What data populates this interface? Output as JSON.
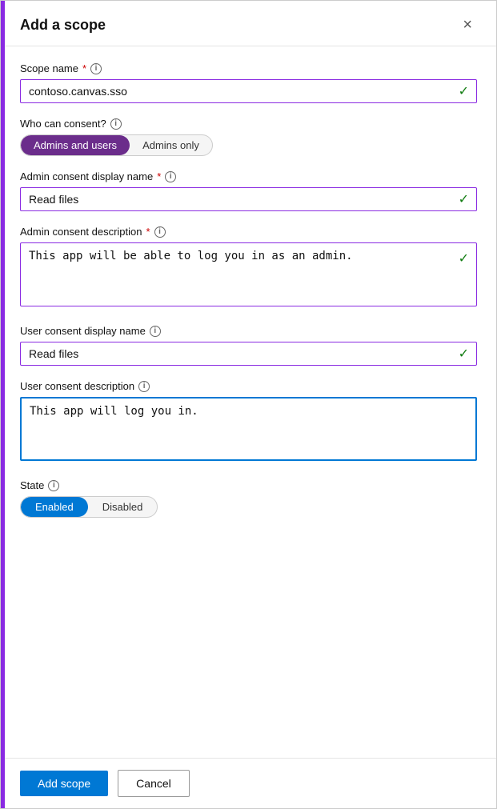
{
  "dialog": {
    "title": "Add a scope",
    "close_label": "×"
  },
  "scope_name": {
    "label": "Scope name",
    "required": true,
    "value": "contoso.canvas.sso",
    "placeholder": ""
  },
  "who_can_consent": {
    "label": "Who can consent?",
    "options": [
      {
        "id": "admins-users",
        "label": "Admins and users",
        "active": true
      },
      {
        "id": "admins-only",
        "label": "Admins only",
        "active": false
      }
    ]
  },
  "admin_consent_display_name": {
    "label": "Admin consent display name",
    "required": true,
    "value": "Read files",
    "placeholder": ""
  },
  "admin_consent_description": {
    "label": "Admin consent description",
    "required": true,
    "value": "This app will be able to log you in as an admin."
  },
  "user_consent_display_name": {
    "label": "User consent display name",
    "value": "Read files"
  },
  "user_consent_description": {
    "label": "User consent description",
    "value": "This app will log you in."
  },
  "state": {
    "label": "State",
    "options": [
      {
        "id": "enabled",
        "label": "Enabled",
        "active": true
      },
      {
        "id": "disabled",
        "label": "Disabled",
        "active": false
      }
    ]
  },
  "footer": {
    "add_button": "Add scope",
    "cancel_button": "Cancel"
  },
  "icons": {
    "info": "i",
    "check": "✓",
    "close": "✕"
  }
}
